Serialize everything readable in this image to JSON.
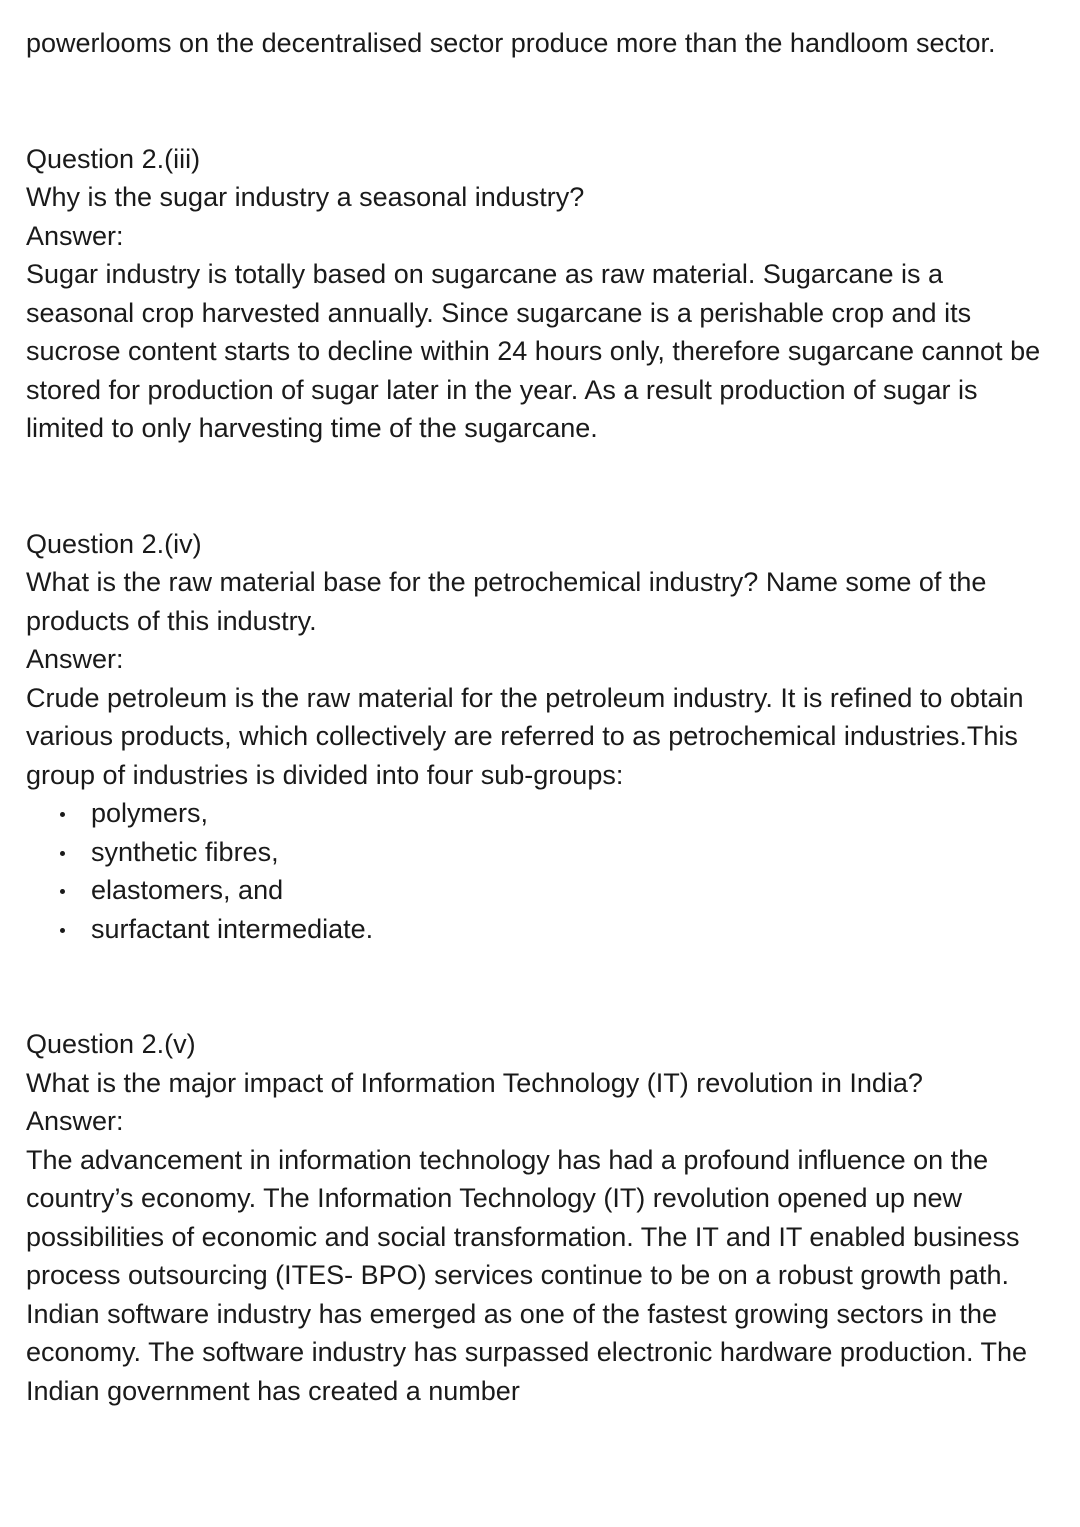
{
  "intro": {
    "text": "powerlooms on the decentralised sector produce more than the handloom sector."
  },
  "questions": [
    {
      "label": "Question 2.(iii)",
      "question": "Why is the sugar industry a seasonal industry?",
      "answer_label": "Answer:",
      "answer": "Sugar industry is totally based on sugarcane as raw material. Sugarcane is a seasonal crop harvested annually. Since sugarcane is a perishable crop and its sucrose content starts to decline within 24 hours only, therefore sugarcane cannot be stored for production of sugar later in the year. As a result production of sugar is limited to only harvesting time of the sugarcane."
    },
    {
      "label": "Question 2.(iv)",
      "question": "What is the raw material base for the petrochemical industry? Name some of the products of this industry.",
      "answer_label": "Answer:",
      "answer": "Crude petroleum is the raw material for the petroleum industry. It is refined to obtain various products, which collectively are referred to as petrochemical industries.This group of industries is divided into four sub-groups:",
      "list": [
        "polymers,",
        "synthetic fibres,",
        "elastomers, and",
        "surfactant intermediate."
      ]
    },
    {
      "label": "Question 2.(v)",
      "question": "What is the major impact of Information Technology (IT) revolution in India?",
      "answer_label": "Answer:",
      "answer": "The advancement in information technology has had a profound influence on the country’s economy. The Information Technology (IT) revolution opened up new possibilities of economic and social transformation. The IT and IT enabled business process outsourcing (ITES- BPO) services continue to be on a robust growth path. Indian software industry has emerged as one of the fastest growing sectors in the economy. The software industry has surpassed electronic hardware production. The Indian government has created a number"
    }
  ]
}
